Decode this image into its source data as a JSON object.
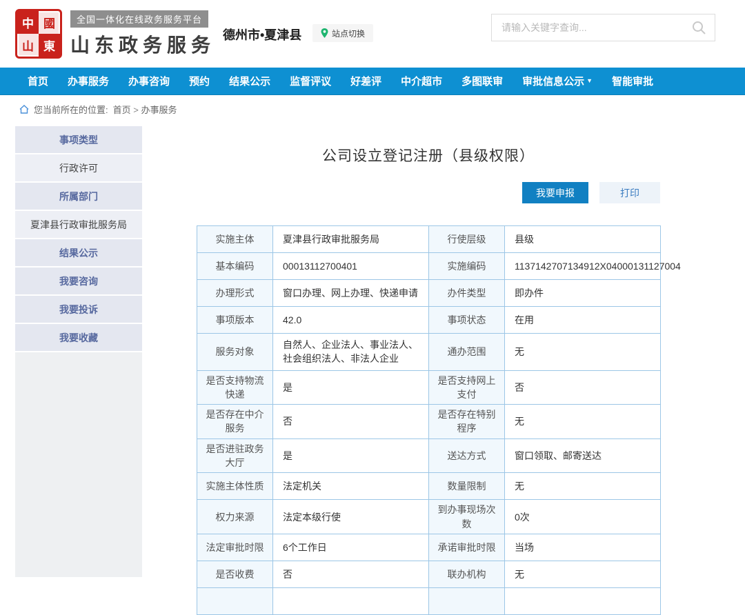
{
  "header": {
    "seal_text": "中國山東",
    "platform_badge": "全国一体化在线政务服务平台",
    "site_name": "山东政务服务",
    "city": "德州市•夏津县",
    "site_switch_label": "站点切换",
    "search_placeholder": "请输入关键字查询..."
  },
  "nav": {
    "items": [
      {
        "label": "首页",
        "has_dropdown": false
      },
      {
        "label": "办事服务",
        "has_dropdown": false
      },
      {
        "label": "办事咨询",
        "has_dropdown": false
      },
      {
        "label": "预约",
        "has_dropdown": false
      },
      {
        "label": "结果公示",
        "has_dropdown": false
      },
      {
        "label": "监督评议",
        "has_dropdown": false
      },
      {
        "label": "好差评",
        "has_dropdown": false
      },
      {
        "label": "中介超市",
        "has_dropdown": false
      },
      {
        "label": "多图联审",
        "has_dropdown": false
      },
      {
        "label": "审批信息公示",
        "has_dropdown": true
      },
      {
        "label": "智能审批",
        "has_dropdown": false
      }
    ]
  },
  "breadcrumb": {
    "prefix": "您当前所在的位置:",
    "items": [
      "首页",
      "办事服务"
    ],
    "separator": ">"
  },
  "sidebar": {
    "items": [
      {
        "label": "事项类型",
        "style": "header"
      },
      {
        "label": "行政许可",
        "style": "sub"
      },
      {
        "label": "所属部门",
        "style": "header"
      },
      {
        "label": "夏津县行政审批服务局",
        "style": "sub"
      },
      {
        "label": "结果公示",
        "style": "header"
      },
      {
        "label": "我要咨询",
        "style": "header"
      },
      {
        "label": "我要投诉",
        "style": "header"
      },
      {
        "label": "我要收藏",
        "style": "header"
      }
    ]
  },
  "main": {
    "title": "公司设立登记注册（县级权限）",
    "apply_button": "我要申报",
    "print_button": "打印",
    "table": {
      "rows": [
        [
          "实施主体",
          "夏津县行政审批服务局",
          "行使层级",
          "县级"
        ],
        [
          "基本编码",
          "00013112700401",
          "实施编码",
          "1137142707134912X04000131127004"
        ],
        [
          "办理形式",
          "窗口办理、网上办理、快递申请",
          "办件类型",
          "即办件"
        ],
        [
          "事项版本",
          "42.0",
          "事项状态",
          "在用"
        ],
        [
          "服务对象",
          "自然人、企业法人、事业法人、社会组织法人、非法人企业",
          "通办范围",
          "无"
        ],
        [
          "是否支持物流快递",
          "是",
          "是否支持网上支付",
          "否"
        ],
        [
          "是否存在中介服务",
          "否",
          "是否存在特别程序",
          "无"
        ],
        [
          "是否进驻政务大厅",
          "是",
          "送达方式",
          "窗口领取、邮寄送达"
        ],
        [
          "实施主体性质",
          "法定机关",
          "数量限制",
          "无"
        ],
        [
          "权力来源",
          "法定本级行使",
          "到办事现场次数",
          "0次"
        ],
        [
          "法定审批时限",
          "6个工作日",
          "承诺审批时限",
          "当场"
        ],
        [
          "是否收费",
          "否",
          "联办机构",
          "无"
        ],
        [
          "",
          "",
          "",
          ""
        ]
      ]
    }
  },
  "colors": {
    "nav_blue": "#0e90d2",
    "apply_button_blue": "#1180c2",
    "print_button_bg": "#edf3f9",
    "table_border": "#9cc6e6",
    "label_cell_bg": "#f1f8fd",
    "sidebar_header_bg": "#e4e7f0",
    "sidebar_header_text": "#57699f",
    "seal_red": "#c9221c",
    "pin_green": "#1fb570"
  }
}
